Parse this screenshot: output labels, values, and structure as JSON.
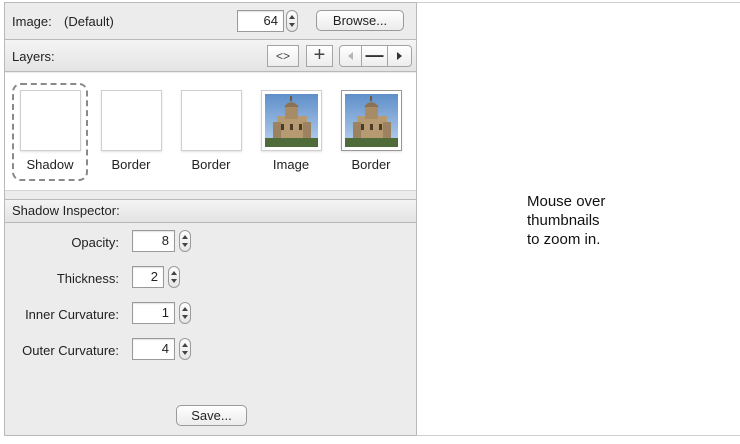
{
  "image_row": {
    "label": "Image:",
    "value": "(Default)",
    "size": "64",
    "browse_label": "Browse..."
  },
  "layers": {
    "label": "Layers:",
    "code_btn": "<>",
    "add_btn": "+",
    "remove_btn": "—"
  },
  "thumbnails": [
    {
      "caption": "Shadow",
      "selected": true,
      "has_image": false
    },
    {
      "caption": "Border",
      "selected": false,
      "has_image": false
    },
    {
      "caption": "Border",
      "selected": false,
      "has_image": false
    },
    {
      "caption": "Image",
      "selected": false,
      "has_image": true
    },
    {
      "caption": "Border",
      "selected": false,
      "has_image": true
    }
  ],
  "inspector": {
    "title": "Shadow Inspector:",
    "fields": [
      {
        "label": "Opacity:",
        "value": "8"
      },
      {
        "label": "Thickness:",
        "value": "2"
      },
      {
        "label": "Inner Curvature:",
        "value": "1"
      },
      {
        "label": "Outer Curvature:",
        "value": "4"
      }
    ],
    "save_label": "Save..."
  },
  "preview": {
    "line1": "Mouse over",
    "line2": "thumbnails",
    "line3": "to zoom in."
  }
}
